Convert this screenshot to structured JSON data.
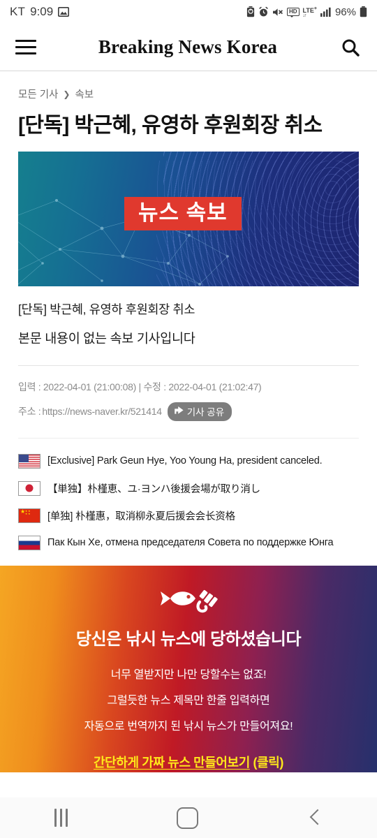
{
  "statusbar": {
    "carrier": "KT",
    "time": "9:09",
    "gallery_icon": "image-icon",
    "battery_saver_icon": "battery-saver-icon",
    "alarm_icon": "alarm-icon",
    "mute_icon": "mute-icon",
    "hd_label": "HD",
    "network_label": "LTE",
    "network_plus": "+",
    "network_arrows": "↓↑",
    "signal_icon": "signal-bars-icon",
    "battery_percent": "96%",
    "battery_icon": "battery-icon"
  },
  "header": {
    "menu_icon": "hamburger-menu-icon",
    "title": "Breaking News Korea",
    "search_icon": "search-icon"
  },
  "article": {
    "breadcrumb": {
      "root": "모든 기사",
      "separator": "❯",
      "current": "속보"
    },
    "headline": "[단독] 박근혜, 유영하 후원회장 취소",
    "hero": {
      "badge": "뉴스 속보",
      "alt": "breaking-news-hero-image"
    },
    "body_lines": [
      "[단독] 박근혜, 유영하 후원회장 취소",
      "본문 내용이 없는 속보 기사입니다"
    ],
    "meta": {
      "timestamps": "입력 : 2022-04-01 (21:00:08) | 수정 : 2022-04-01 (21:02:47)",
      "address_label": "주소 : ",
      "address_url": "https://news-naver.kr/521414",
      "share_button": "기사 공유",
      "share_icon": "share-icon"
    }
  },
  "translations": [
    {
      "flag": "us-flag-icon",
      "text": "[Exclusive] Park Geun Hye, Yoo Young Ha, president canceled."
    },
    {
      "flag": "japan-flag-icon",
      "text": "【単独】朴槿恵、ユ·ヨンハ後援会場が取り消し"
    },
    {
      "flag": "china-flag-icon",
      "text": "[单独] 朴槿惠，取消柳永夏后援会会长资格"
    },
    {
      "flag": "russia-flag-icon",
      "text": "Пак Кын Хе, отмена председателя Совета по поддержке Юнга"
    }
  ],
  "promo": {
    "icon": "fish-hook-icon",
    "title": "당신은 낚시 뉴스에 당하셨습니다",
    "lines": [
      "너무 열받지만 나만 당할수는 없죠!",
      "그럴듯한 뉴스 제목만 한줄 입력하면",
      "자동으로 번역까지 된 낚시 뉴스가 만들어져요!"
    ],
    "cta_underlined": "간단하게 가짜 뉴스 만들어보기",
    "cta_suffix": " (클릭)",
    "colors": {
      "gradient_start": "#f5a623",
      "gradient_mid": "#c01a25",
      "gradient_end": "#26306c",
      "cta": "#ffe81a"
    }
  },
  "navbar": {
    "recent_icon": "recents-icon",
    "home_icon": "home-icon",
    "back_icon": "back-icon"
  }
}
